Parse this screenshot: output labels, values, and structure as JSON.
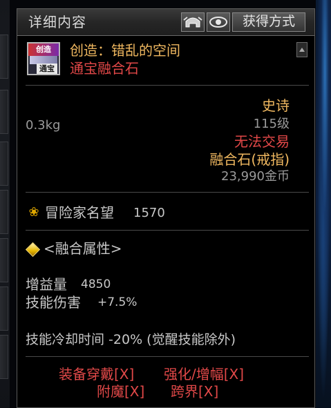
{
  "window": {
    "title": "详细内容",
    "obtain_button": "获得方式"
  },
  "item": {
    "icon_top_text": "创造",
    "icon_badge": "通宝",
    "name": "创造：错乱的空间",
    "type": "通宝融合石"
  },
  "properties": {
    "weight": "0.3kg",
    "rarity": "史诗",
    "level": "115级",
    "trade": "无法交易",
    "category": "融合石(戒指)",
    "price": "23,990金币"
  },
  "fame": {
    "label": "冒险家名望",
    "value": "1570"
  },
  "fusion": {
    "title": "<融合属性>",
    "stats": [
      {
        "label": "增益量",
        "value": "4850"
      },
      {
        "label": "技能伤害",
        "value": "+7.5%"
      }
    ],
    "cooldown": "技能冷却时间 -20% (觉醒技能除外)"
  },
  "restrictions": [
    "装备穿戴[X]",
    "强化/增幅[X]",
    "附魔[X]",
    "跨界[X]"
  ],
  "colors": {
    "name": "#f0b860",
    "rarity": "#f0b860",
    "restriction": "#e04848"
  },
  "icons": [
    "helmet-icon",
    "eye-icon",
    "fame-icon",
    "diamond-icon",
    "scroll-up-icon"
  ]
}
